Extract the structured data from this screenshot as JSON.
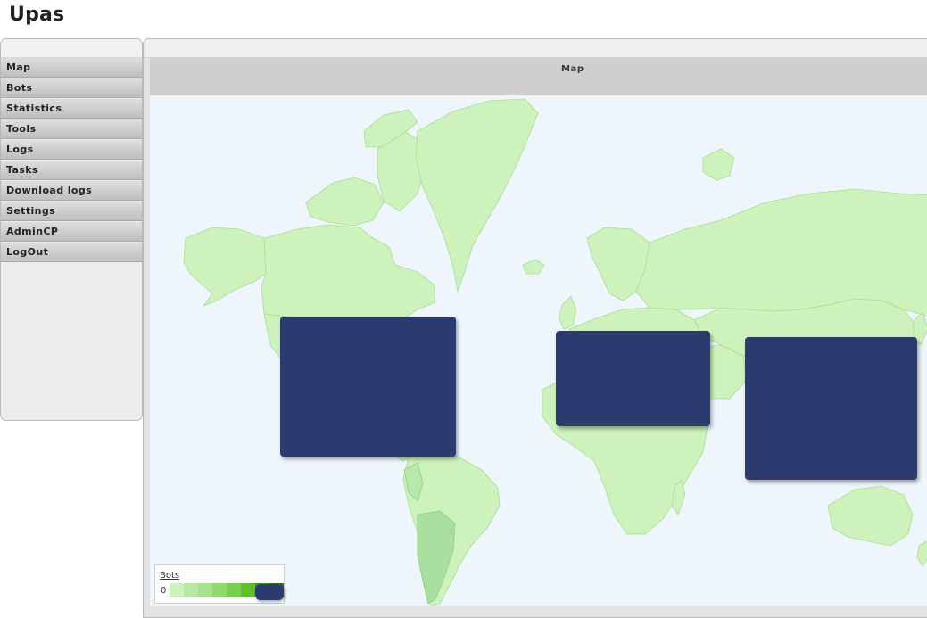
{
  "app": {
    "title": "Upas"
  },
  "sidebar": {
    "items": [
      {
        "label": "Map"
      },
      {
        "label": "Bots"
      },
      {
        "label": "Statistics"
      },
      {
        "label": "Tools"
      },
      {
        "label": "Logs"
      },
      {
        "label": "Tasks"
      },
      {
        "label": "Download logs"
      },
      {
        "label": "Settings"
      },
      {
        "label": "AdminCP"
      },
      {
        "label": "LogOut"
      }
    ]
  },
  "map": {
    "title": "Map",
    "legend": {
      "title": "Bots",
      "min_label": "0"
    },
    "colors": {
      "ocean": "#eef5fb",
      "land": "#cdf2bc",
      "border": "#a9dc98",
      "highlight": "#a9e0a0",
      "redaction": "#2b3b6f"
    },
    "legend_colors": [
      "#cdf2bc",
      "#b8e9a4",
      "#a5e28b",
      "#8fd96d",
      "#78cf4b",
      "#5fc12a",
      "#3f9b1a",
      "#2c7a12"
    ]
  }
}
